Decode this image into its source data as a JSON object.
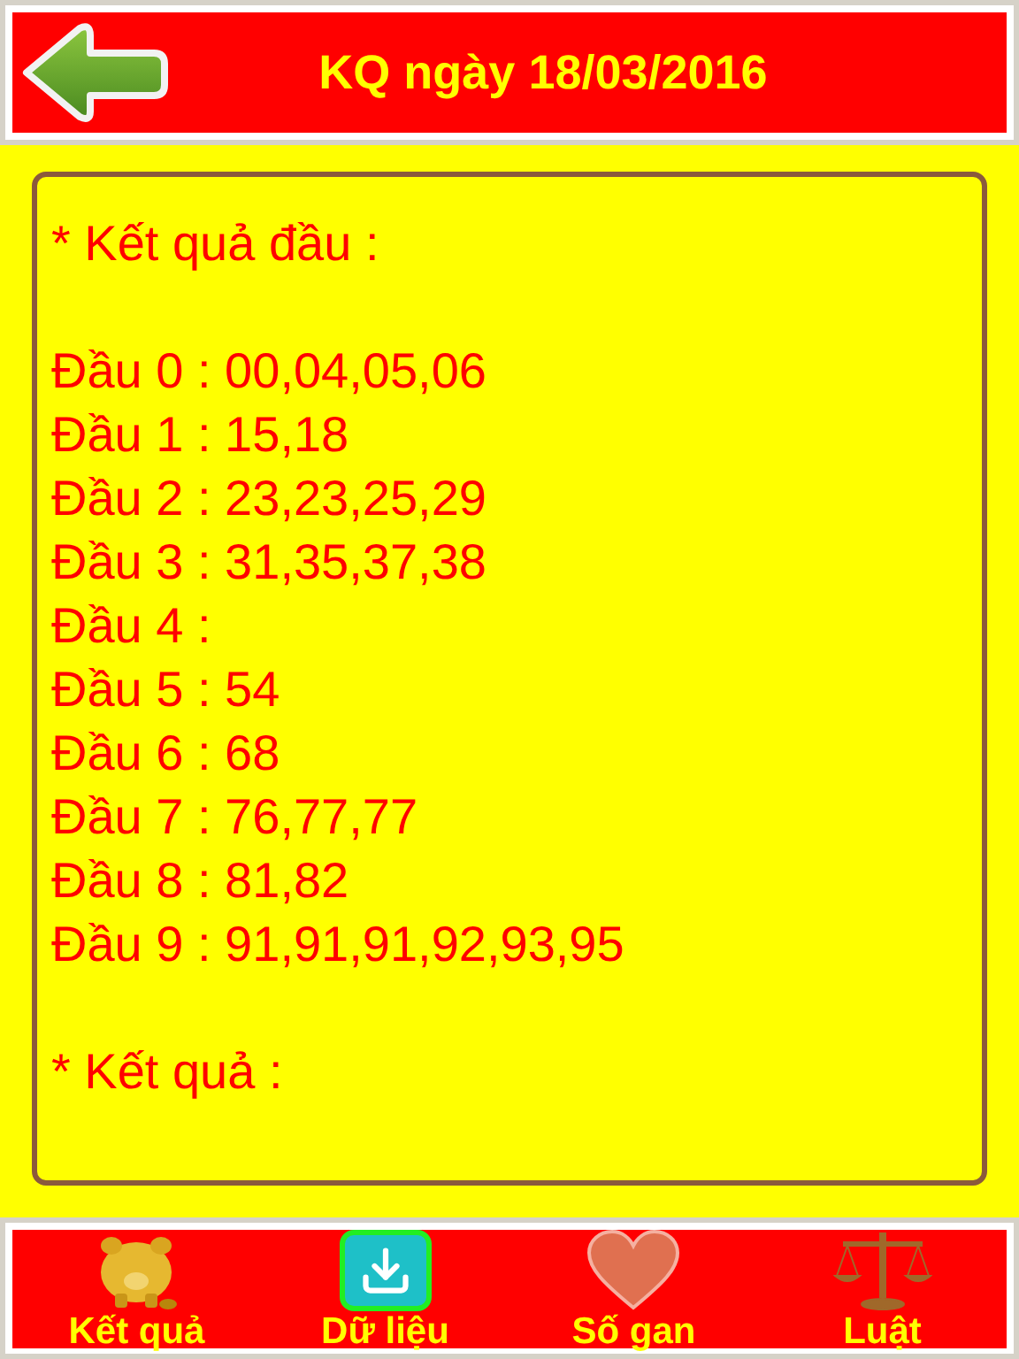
{
  "header": {
    "title": "KQ ngày 18/03/2016"
  },
  "sections": [
    {
      "heading": "* Kết quả đầu :",
      "rows": [
        "Đầu 0 : 00,04,05,06",
        "Đầu 1 : 15,18",
        "Đầu 2 : 23,23,25,29",
        "Đầu 3 : 31,35,37,38",
        "Đầu 4 :",
        "Đầu 5 : 54",
        "Đầu 6 : 68",
        "Đầu 7 : 76,77,77",
        "Đầu 8 : 81,82",
        "Đầu 9 : 91,91,91,92,93,95"
      ]
    },
    {
      "heading": "* Kết quả :"
    }
  ],
  "tabs": [
    {
      "label": "Kết quả",
      "kind": "piggy",
      "selected": false
    },
    {
      "label": "Dữ liệu",
      "kind": "download",
      "selected": true
    },
    {
      "label": "Số gan",
      "kind": "heart",
      "selected": false
    },
    {
      "label": "Luật",
      "kind": "scales",
      "selected": false
    }
  ]
}
